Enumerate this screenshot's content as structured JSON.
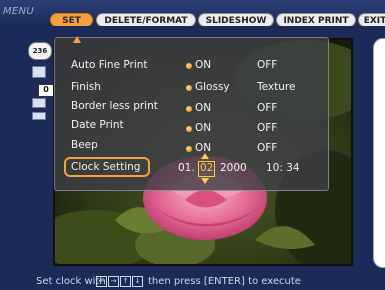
{
  "menu": {
    "title": "MENU",
    "tabs": [
      {
        "label": "SET",
        "active": true
      },
      {
        "label": "DELETE/FORMAT",
        "active": false
      },
      {
        "label": "SLIDESHOW",
        "active": false
      },
      {
        "label": "INDEX PRINT",
        "active": false
      },
      {
        "label": "EXIT",
        "active": false
      }
    ]
  },
  "sidebar": {
    "count": "236",
    "zero": "0"
  },
  "settings": {
    "rows": [
      {
        "label": "Auto Fine Print",
        "opt1": "ON",
        "opt2": "OFF"
      },
      {
        "label": "Finish",
        "opt1": "Glossy",
        "opt2": "Texture"
      },
      {
        "label": "Border less print",
        "opt1": "ON",
        "opt2": "OFF"
      },
      {
        "label": "Date Print",
        "opt1": "ON",
        "opt2": "OFF"
      },
      {
        "label": "Beep",
        "opt1": "ON",
        "opt2": "OFF"
      }
    ],
    "clock": {
      "label": "Clock Setting",
      "day": "01.",
      "month": "02",
      "year": "2000",
      "time": "10: 34"
    }
  },
  "status": {
    "prefix": "Set clock with",
    "suffix": "then press [ENTER] to execute",
    "keys": [
      "←",
      "→",
      "↑",
      "↓"
    ]
  },
  "colors": {
    "accent": "#f5a23a",
    "background": "#1b2a57",
    "highlight": "#f5d23a"
  }
}
